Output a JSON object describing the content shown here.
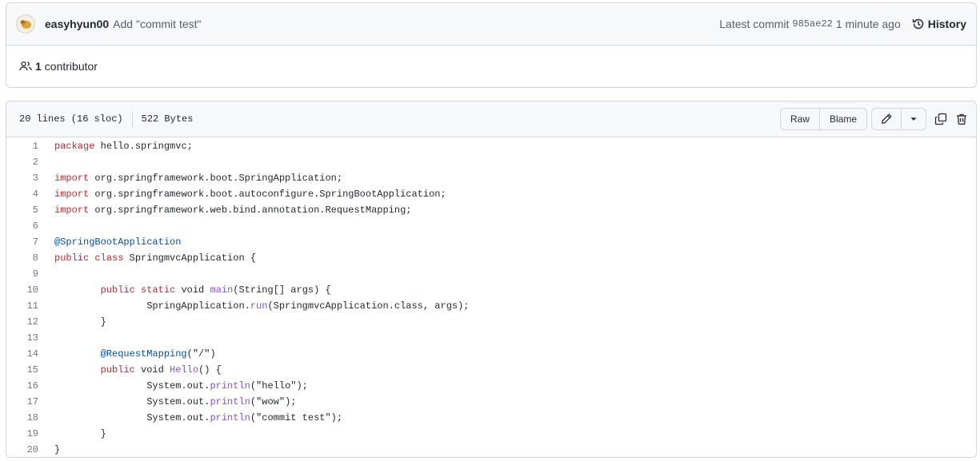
{
  "commit": {
    "author": "easyhyun00",
    "message": "Add \"commit test\"",
    "latest_label": "Latest commit",
    "sha": "985ae22",
    "time_ago": "1 minute ago",
    "history_label": "History"
  },
  "contributors": {
    "count": "1",
    "label": "contributor"
  },
  "file": {
    "lines_info": "20 lines (16 sloc)",
    "size": "522 Bytes",
    "raw_label": "Raw",
    "blame_label": "Blame"
  },
  "code_lines": [
    {
      "n": "1",
      "segs": [
        {
          "t": "package",
          "c": "kw"
        },
        {
          "t": " hello.springmvc;",
          "c": ""
        }
      ]
    },
    {
      "n": "2",
      "segs": []
    },
    {
      "n": "3",
      "segs": [
        {
          "t": "import",
          "c": "kw"
        },
        {
          "t": " org.springframework.boot.SpringApplication;",
          "c": ""
        }
      ]
    },
    {
      "n": "4",
      "segs": [
        {
          "t": "import",
          "c": "kw"
        },
        {
          "t": " org.springframework.boot.autoconfigure.SpringBootApplication;",
          "c": ""
        }
      ]
    },
    {
      "n": "5",
      "segs": [
        {
          "t": "import",
          "c": "kw"
        },
        {
          "t": " org.springframework.web.bind.annotation.RequestMapping;",
          "c": ""
        }
      ]
    },
    {
      "n": "6",
      "segs": []
    },
    {
      "n": "7",
      "segs": [
        {
          "t": "@SpringBootApplication",
          "c": "an"
        }
      ]
    },
    {
      "n": "8",
      "segs": [
        {
          "t": "public",
          "c": "kw"
        },
        {
          "t": " ",
          "c": ""
        },
        {
          "t": "class",
          "c": "kw"
        },
        {
          "t": " SpringmvcApplication {",
          "c": ""
        }
      ]
    },
    {
      "n": "9",
      "segs": []
    },
    {
      "n": "10",
      "segs": [
        {
          "t": "\t",
          "c": ""
        },
        {
          "t": "public",
          "c": "kw"
        },
        {
          "t": " ",
          "c": ""
        },
        {
          "t": "static",
          "c": "kw"
        },
        {
          "t": " void ",
          "c": ""
        },
        {
          "t": "main",
          "c": "fn"
        },
        {
          "t": "(String[] args) {",
          "c": ""
        }
      ]
    },
    {
      "n": "11",
      "segs": [
        {
          "t": "\t\tSpringApplication.",
          "c": ""
        },
        {
          "t": "run",
          "c": "fn"
        },
        {
          "t": "(SpringmvcApplication.class, args);",
          "c": ""
        }
      ]
    },
    {
      "n": "12",
      "segs": [
        {
          "t": "\t}",
          "c": ""
        }
      ]
    },
    {
      "n": "13",
      "segs": []
    },
    {
      "n": "14",
      "segs": [
        {
          "t": "\t",
          "c": ""
        },
        {
          "t": "@RequestMapping",
          "c": "an"
        },
        {
          "t": "(\"/\")",
          "c": ""
        }
      ]
    },
    {
      "n": "15",
      "segs": [
        {
          "t": "\t",
          "c": ""
        },
        {
          "t": "public",
          "c": "kw"
        },
        {
          "t": " void ",
          "c": ""
        },
        {
          "t": "Hello",
          "c": "fn"
        },
        {
          "t": "() {",
          "c": ""
        }
      ]
    },
    {
      "n": "16",
      "segs": [
        {
          "t": "\t\tSystem.out.",
          "c": ""
        },
        {
          "t": "println",
          "c": "fn"
        },
        {
          "t": "(\"hello\");",
          "c": ""
        }
      ]
    },
    {
      "n": "17",
      "segs": [
        {
          "t": "\t\tSystem.out.",
          "c": ""
        },
        {
          "t": "println",
          "c": "fn"
        },
        {
          "t": "(\"wow\");",
          "c": ""
        }
      ]
    },
    {
      "n": "18",
      "segs": [
        {
          "t": "\t\tSystem.out.",
          "c": ""
        },
        {
          "t": "println",
          "c": "fn"
        },
        {
          "t": "(\"commit test\");",
          "c": ""
        }
      ]
    },
    {
      "n": "19",
      "segs": [
        {
          "t": "\t}",
          "c": ""
        }
      ]
    },
    {
      "n": "20",
      "segs": [
        {
          "t": "}",
          "c": ""
        }
      ]
    }
  ],
  "icons": {
    "avatar": "user-avatar",
    "history": "history-clock-icon",
    "contributors": "people-icon",
    "edit": "pencil-icon",
    "dropdown": "triangle-down-icon",
    "copy": "copy-icon",
    "delete": "trash-icon"
  }
}
